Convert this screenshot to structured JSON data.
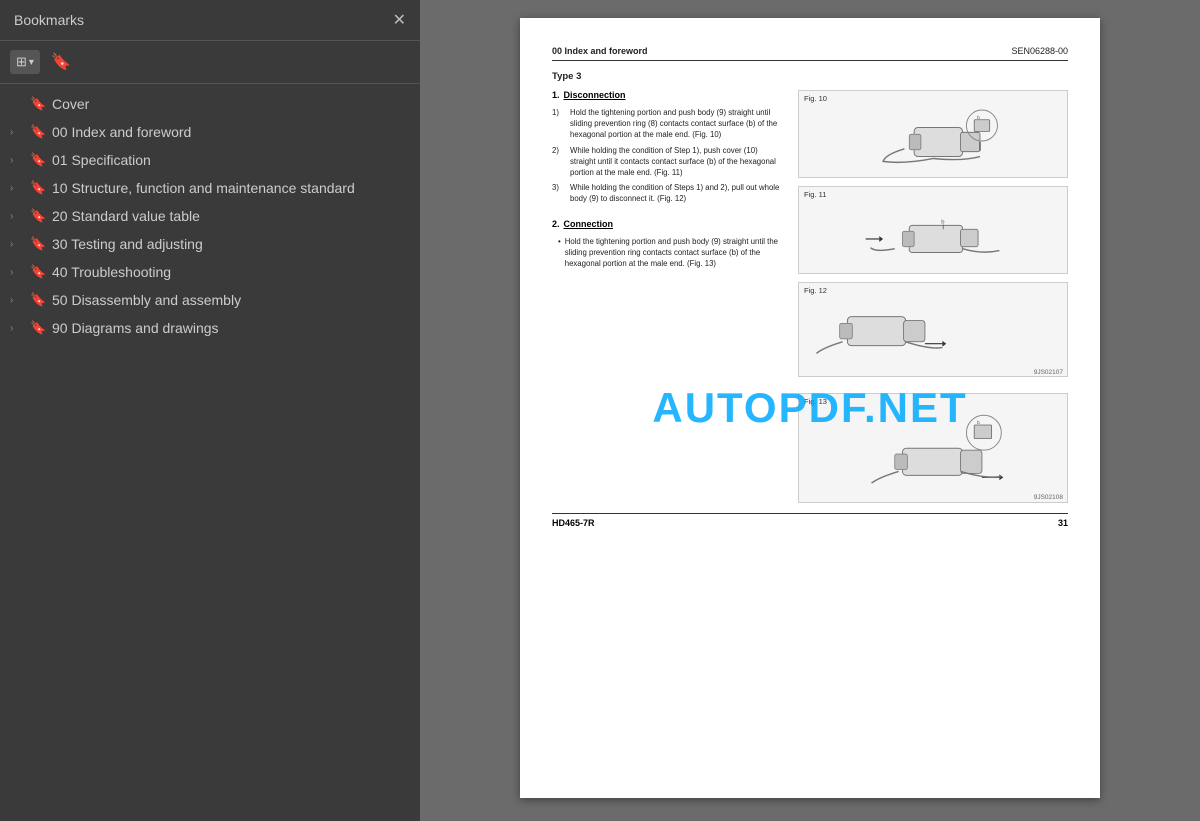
{
  "sidebar": {
    "title": "Bookmarks",
    "close_label": "✕",
    "toolbar": {
      "layout_btn": "⊞",
      "layout_dropdown": "▾",
      "bookmark_btn": "🔖"
    },
    "items": [
      {
        "id": "cover",
        "label": "Cover",
        "has_children": false,
        "expanded": false
      },
      {
        "id": "00-index",
        "label": "00 Index and foreword",
        "has_children": true,
        "expanded": false
      },
      {
        "id": "01-spec",
        "label": "01 Specification",
        "has_children": true,
        "expanded": false
      },
      {
        "id": "10-structure",
        "label": "10 Structure, function and maintenance standard",
        "has_children": true,
        "expanded": false
      },
      {
        "id": "20-standard",
        "label": "20 Standard value table",
        "has_children": true,
        "expanded": false
      },
      {
        "id": "30-testing",
        "label": "30 Testing and adjusting",
        "has_children": true,
        "expanded": false
      },
      {
        "id": "40-trouble",
        "label": "40 Troubleshooting",
        "has_children": true,
        "expanded": false
      },
      {
        "id": "50-disassembly",
        "label": "50 Disassembly and assembly",
        "has_children": true,
        "expanded": false
      },
      {
        "id": "90-diagrams",
        "label": "90 Diagrams and drawings",
        "has_children": true,
        "expanded": false
      }
    ]
  },
  "document": {
    "header_left": "00 Index and foreword",
    "header_right": "SEN06288-00",
    "type_label": "Type 3",
    "section1": {
      "num": "1.",
      "title": "Disconnection",
      "steps": [
        {
          "num": "1)",
          "text": "Hold the tightening portion and push body (9) straight until sliding prevention ring (8) contacts contact surface (b) of the hexagonal portion at the male end. (Fig. 10)"
        },
        {
          "num": "2)",
          "text": "While holding the condition of Step 1), push cover (10) straight until it contacts contact surface (b) of the hexagonal portion at the male end. (Fig. 11)"
        },
        {
          "num": "3)",
          "text": "While holding the condition of Steps 1) and 2), pull out whole body (9) to disconnect it. (Fig. 12)"
        }
      ]
    },
    "section2": {
      "num": "2.",
      "title": "Connection",
      "bullets": [
        {
          "text": "Hold the tightening portion and push body (9) straight until the sliding prevention ring contacts contact surface (b) of the hexagonal portion at the male end. (Fig. 13)"
        }
      ]
    },
    "figures": [
      {
        "label": "Fig. 10",
        "id": "fig10"
      },
      {
        "label": "Fig. 11",
        "id": "fig11"
      },
      {
        "label": "Fig. 12",
        "id": "fig12"
      },
      {
        "label": "Fig. 13",
        "id": "fig13"
      }
    ],
    "figure_codes": {
      "fig12_code": "9JS02107",
      "fig13_code": "9JS02108"
    },
    "footer_left": "HD465-7R",
    "footer_right": "31",
    "watermark": "AUTOPDF.NET"
  }
}
